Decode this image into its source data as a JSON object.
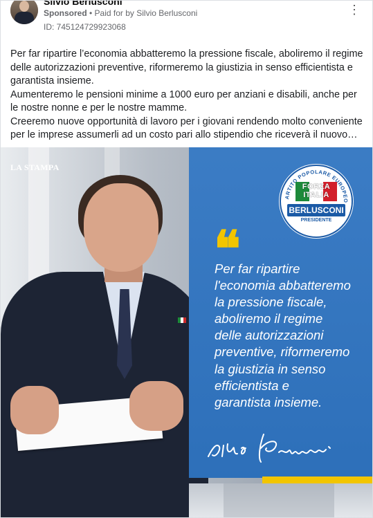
{
  "post": {
    "page_name": "Silvio Berlusconi",
    "sponsored_label": "Sponsored",
    "paid_by": "• Paid for by Silvio Berlusconi",
    "ad_id": "ID: 745124729923068",
    "more_icon": "more-options-icon",
    "body_lines": [
      "Per far ripartire l’economia abbatteremo la pressione fiscale, aboliremo il regime delle autorizzazioni preventive, riformeremo la giustizia in senso efficientista e garantista insieme.",
      "Aumenteremo le pensioni minime a 1000 euro per anziani e disabili, anche per le nostre nonne e per le nostre mamme.",
      "Creeremo nuove opportunità di lavoro per i giovani rendendo molto conveniente per le imprese assumerli ad un costo pari allo stipendio che riceverà il nuovo…"
    ]
  },
  "banner": {
    "watermark": "LA STAMPA",
    "logo": {
      "ring_text": "PARTITO POPOLARE EUROPEO",
      "line1": "FORZA",
      "line2": "ITALIA",
      "name": "BERLUSCONI",
      "role": "PRESIDENTE"
    },
    "quote_mark": "“",
    "quote_lines": [
      "Per far ripartire",
      "l'economia abbatteremo",
      "la pressione fiscale,",
      "aboliremo il regime",
      "delle autorizzazioni",
      "preventive, riformeremo",
      "la giustizia in senso",
      "efficientista e",
      "garantista insieme."
    ],
    "colors": {
      "panel_blue": "#2f74c1",
      "accent_yellow": "#f2c500"
    }
  }
}
